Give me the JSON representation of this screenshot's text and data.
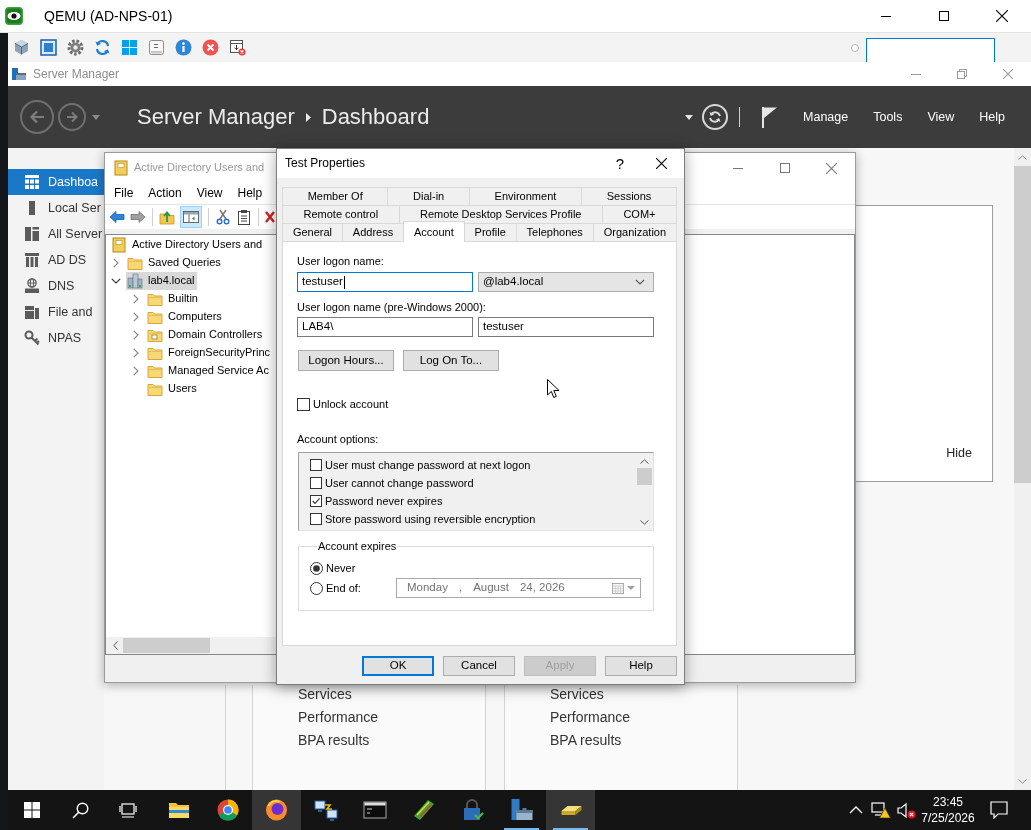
{
  "qemu": {
    "title": "QEMU (AD-NPS-01)"
  },
  "server_manager": {
    "title": "Server Manager",
    "breadcrumb": [
      "Server Manager",
      "Dashboard"
    ],
    "menus": [
      "Manage",
      "Tools",
      "View",
      "Help"
    ],
    "nav": [
      {
        "label": "Dashboa",
        "selected": true
      },
      {
        "label": "Local Ser",
        "selected": false
      },
      {
        "label": "All Server",
        "selected": false
      },
      {
        "label": "AD DS",
        "selected": false
      },
      {
        "label": "DNS",
        "selected": false
      },
      {
        "label": "File and",
        "selected": false
      },
      {
        "label": "NPAS",
        "selected": false
      }
    ],
    "welcome": {
      "hide": "Hide"
    },
    "tiles": [
      {
        "links": [
          "Services",
          "Performance",
          "BPA results"
        ]
      },
      {
        "links": [
          "Services",
          "Performance",
          "BPA results"
        ]
      }
    ]
  },
  "ad_window": {
    "title": "Active Directory Users and",
    "menus": [
      "File",
      "Action",
      "View",
      "Help"
    ],
    "toolbar": [
      {
        "pressed": false
      },
      {
        "pressed": false
      },
      {
        "pressed": false
      },
      {
        "pressed": true
      },
      {
        "pressed": false
      },
      {
        "pressed": false
      },
      {
        "pressed": false
      }
    ],
    "tree": [
      {
        "label": "Active Directory Users and",
        "kind": "root",
        "expandable": false,
        "selected": false,
        "children": [
          {
            "label": "Saved Queries",
            "kind": "container",
            "expandable": true,
            "expanded": false,
            "selected": false
          },
          {
            "label": "lab4.local",
            "kind": "domain",
            "expandable": true,
            "expanded": true,
            "selected": true,
            "children": [
              {
                "label": "Builtin",
                "kind": "container",
                "expandable": true,
                "expanded": false,
                "selected": false
              },
              {
                "label": "Computers",
                "kind": "container",
                "expandable": true,
                "expanded": false,
                "selected": false
              },
              {
                "label": "Domain Controllers",
                "kind": "ou",
                "expandable": true,
                "expanded": false,
                "selected": false
              },
              {
                "label": "ForeignSecurityPrinc",
                "kind": "container",
                "expandable": true,
                "expanded": false,
                "selected": false
              },
              {
                "label": "Managed Service Ac",
                "kind": "container",
                "expandable": true,
                "expanded": false,
                "selected": false
              },
              {
                "label": "Users",
                "kind": "container",
                "expandable": false,
                "selected": false
              }
            ]
          }
        ]
      }
    ]
  },
  "dialog": {
    "title": "Test Properties",
    "help": "?",
    "tab_rows": [
      [
        {
          "label": "Member Of",
          "selected": false
        },
        {
          "label": "Dial-in",
          "selected": false
        },
        {
          "label": "Environment",
          "selected": false
        },
        {
          "label": "Sessions",
          "selected": false
        }
      ],
      [
        {
          "label": "Remote control",
          "selected": false
        },
        {
          "label": "Remote Desktop Services Profile",
          "selected": false
        },
        {
          "label": "COM+",
          "selected": false
        }
      ],
      [
        {
          "label": "General",
          "selected": false
        },
        {
          "label": "Address",
          "selected": false
        },
        {
          "label": "Account",
          "selected": true
        },
        {
          "label": "Profile",
          "selected": false
        },
        {
          "label": "Telephones",
          "selected": false
        },
        {
          "label": "Organization",
          "selected": false
        }
      ]
    ],
    "account": {
      "logon_label": "User logon name:",
      "logon_name": {
        "value": "testuser",
        "focused": true
      },
      "suffix": "@lab4.local",
      "legacy_label": "User logon name (pre-Windows 2000):",
      "legacy_domain": "LAB4\\",
      "legacy_name": "testuser",
      "actions": [
        "Logon Hours...",
        "Log On To..."
      ],
      "unlock": {
        "label": "Unlock account",
        "checked": false
      },
      "options_label": "Account options:",
      "options": [
        {
          "label": "User must change password at next logon",
          "checked": false
        },
        {
          "label": "User cannot change password",
          "checked": false
        },
        {
          "label": "Password never expires",
          "checked": true
        },
        {
          "label": "Store password using reversible encryption",
          "checked": false
        }
      ],
      "expires": {
        "legend": "Account expires",
        "choices": [
          {
            "label": "Never",
            "selected": true
          },
          {
            "label": "End of:",
            "selected": false
          }
        ],
        "date": {
          "parts": [
            "Monday",
            ",",
            "August",
            "24, 2026"
          ],
          "disabled": true
        }
      }
    },
    "buttons": [
      {
        "label": "OK",
        "default": true,
        "disabled": false
      },
      {
        "label": "Cancel",
        "default": false,
        "disabled": false
      },
      {
        "label": "Apply",
        "default": false,
        "disabled": true
      },
      {
        "label": "Help",
        "default": false,
        "disabled": false
      }
    ]
  },
  "taskbar": {
    "apps": [
      {
        "running": false,
        "highlighted": false
      },
      {
        "running": false,
        "highlighted": false
      },
      {
        "running": false,
        "highlighted": true
      },
      {
        "running": false,
        "highlighted": false
      },
      {
        "running": false,
        "highlighted": false
      },
      {
        "running": false,
        "highlighted": false
      },
      {
        "running": false,
        "highlighted": false
      },
      {
        "running": true,
        "highlighted": false
      },
      {
        "running": true,
        "highlighted": true
      }
    ],
    "time": "23:45",
    "date": "7/25/2026"
  }
}
